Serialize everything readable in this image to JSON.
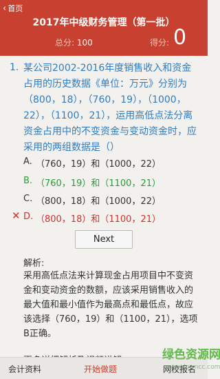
{
  "header": {
    "back_label": "首页",
    "title": "2017年中级财务管理（第一批）",
    "total_label": "总分:",
    "total_value": "100",
    "score_label": "得分:",
    "score_value": "0"
  },
  "question": {
    "number": "1.",
    "text": "某公司2002-2016年度销售收入和资金占用的历史数据《单位：万元》分别为（800，18），（760，19），（1000，22），（1100，21），运用高低点法分离资金占用中的不变资金与变动资金时，应采用的两组数据是（）"
  },
  "options": [
    {
      "letter": "A.",
      "text": "（760，19）和（1000，22）"
    },
    {
      "letter": "B.",
      "text": "（760，19）和（1100，21）"
    },
    {
      "letter": "C.",
      "text": "（800，18）和（1000，22）"
    },
    {
      "letter": "D.",
      "text": "（800，18）和（1100，21）",
      "mark": "✕"
    }
  ],
  "next_label": "Next",
  "analysis": {
    "title": "解析:",
    "text": "采用高低点法来计算现金占用项目中不变资金和变动资金的数额，应该采用销售收入的最大值和最小值作为最高点和最低点，故应该选择（760，19）和（1100，21），选项B正确。",
    "more": "更多详细解析及视频讲解"
  },
  "bottom_nav": {
    "left": "会计资料",
    "middle": "开始做题",
    "right": "网校报名"
  },
  "watermark": {
    "logo": "绿色资源网",
    "url": "www.downcc.com"
  },
  "colors": {
    "header_bg": "#c8402f",
    "question_text": "#2e7cc4",
    "correct": "#2a9b3a",
    "wrong": "#d4302a"
  }
}
